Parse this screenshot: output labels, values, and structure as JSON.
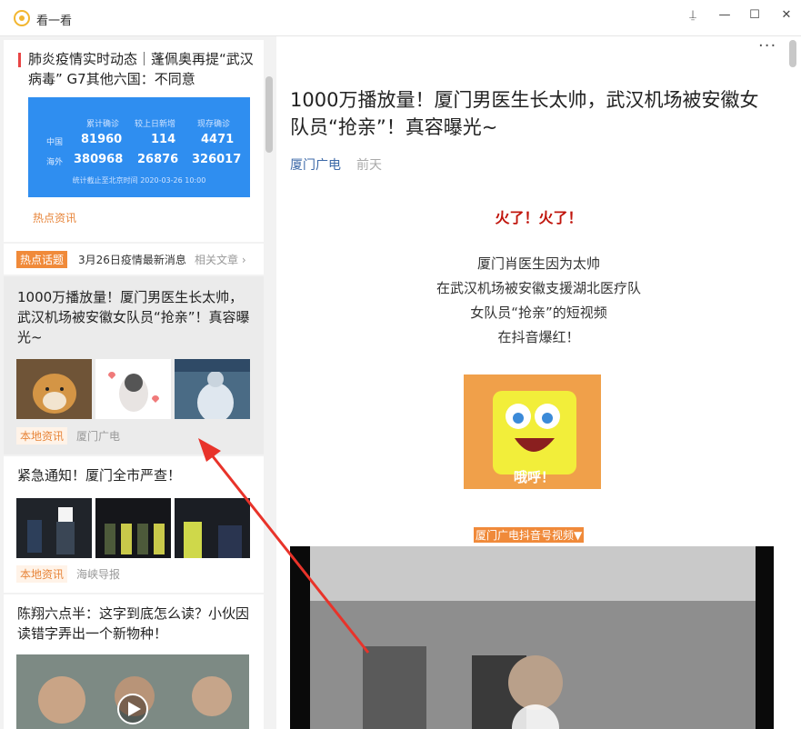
{
  "window": {
    "title": "看一看",
    "pin_icon": "⍊",
    "min_icon": "—",
    "max_icon": "☐",
    "close_icon": "✕"
  },
  "feed": {
    "card1": {
      "title": "肺炎疫情实时动态｜蓬佩奥再提“武汉病毒” G7其他六国：不同意",
      "tag": "热点资讯",
      "covid": {
        "headers": [
          "累计确诊",
          "较上日新增",
          "现存确诊"
        ],
        "rows": [
          {
            "label": "中国",
            "values": [
              "81960",
              "114",
              "4471"
            ]
          },
          {
            "label": "海外",
            "values": [
              "380968",
              "26876",
              "326017"
            ]
          }
        ],
        "footnote": "统计截止至北京时间 2020-03-26 10:00"
      }
    },
    "hot": {
      "badge": "热点话题",
      "text": "3月26日疫情最新消息",
      "link": "相关文章 ›"
    },
    "card2": {
      "title": "1000万播放量！厦门男医生长太帅，武汉机场被安徽女队员“抢亲”！真容曝光~",
      "tag": "本地资讯",
      "source": "厦门广电"
    },
    "card3": {
      "title": "紧急通知！厦门全市严查！",
      "tag": "本地资讯",
      "source": "海峡导报"
    },
    "card4": {
      "title": "陈翔六点半：这字到底怎么读？小伙因读错字弄出一个新物种！"
    }
  },
  "article": {
    "more": "···",
    "title": "1000万播放量！厦门男医生长太帅，武汉机场被安徽女队员“抢亲”！真容曝光~",
    "source": "厦门广电",
    "time": "前天",
    "highlight": "火了！火了！",
    "paragraphs": [
      "厦门肖医生因为太帅",
      "在武汉机场被安徽支援湖北医疗队",
      "女队员“抢亲”的短视频",
      "在抖音爆红！"
    ],
    "sponge_caption": "哦呼！",
    "douyin_label": "厦门广电抖音号视频▼"
  },
  "colors": {
    "accent": "#f08a3a",
    "source_blue": "#3d6aa8",
    "highlight_red": "#c0150c",
    "covid_blue": "#2f8ef0",
    "arrow_red": "#e8332a"
  }
}
